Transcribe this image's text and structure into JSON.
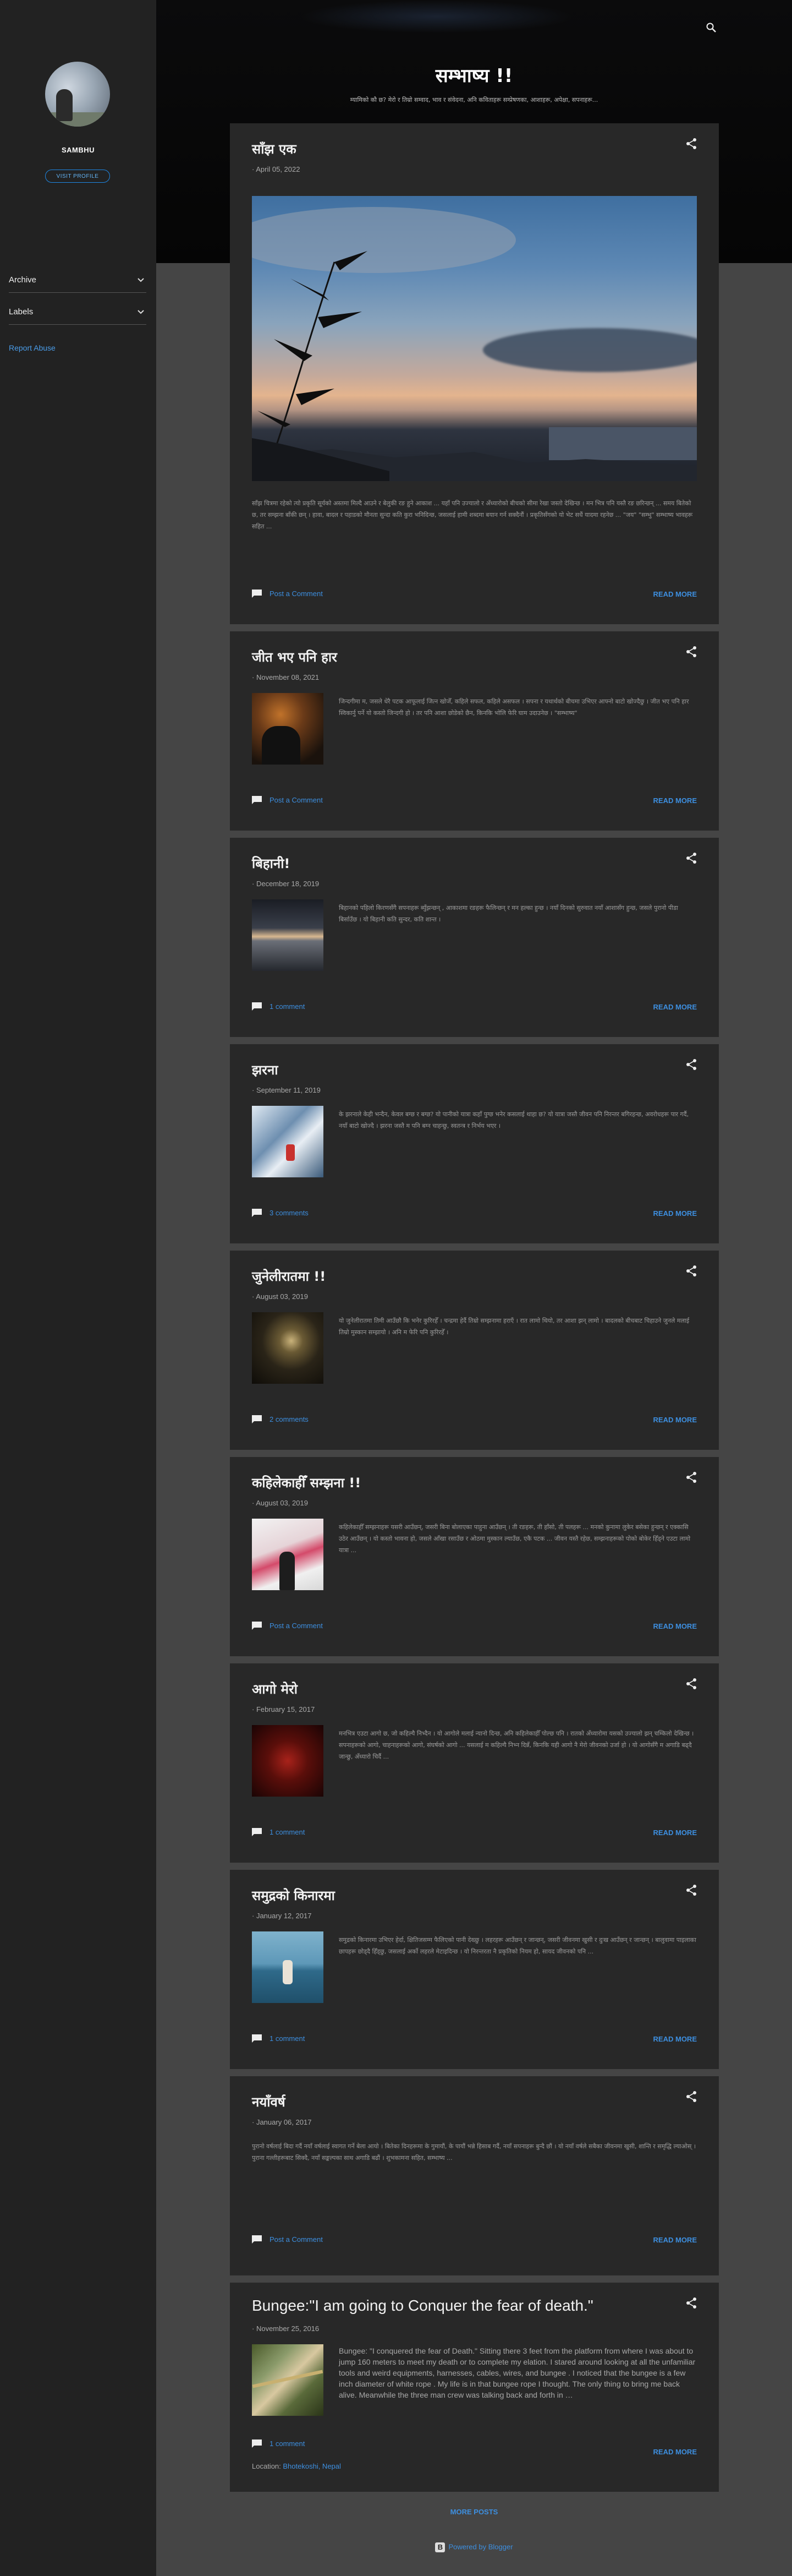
{
  "sidebar": {
    "profile_name": "SAMBHU",
    "visit_label": "VISIT PROFILE",
    "widgets": [
      {
        "label": "Archive"
      },
      {
        "label": "Labels"
      }
    ],
    "report_abuse": "Report Abuse"
  },
  "header": {
    "title": "सम्भाष्य !!",
    "description": "म्यामिको कौ छ? मेरो र तिम्रो सम्वाद, भाव र संवेदना, अनि कविताहरू सम्प्रेषणका, आशाहरू, अपेक्षा, सपनाहरू..."
  },
  "posts": [
    {
      "title": "साँझ एक",
      "date": "April 05, 2022",
      "snippet": "साँझ चित्रमा रहेको त्यो प्रकृति सूर्यको अस्तमा मिल्दै आउने र बेलुकी रङ हुने आकाश ... यहाँ पनि उज्यालो र अँध्यारोको बीचको सीमा रेखा जस्तो देखिन्छ । मन भित्र पनि यस्तै रङ छरिन्छन् ... समय बितेको छ, तर सम्झना बाँकी छन् । हावा, बादल र पहाडको मौनता सुन्दा कति कुरा भनिदिन्छ, जसलाई हामी शब्दमा बयान गर्न सक्दैनौं । प्रकृतिसँगको यो भेट सधैं यादमा रहनेछ ... \"जय\" \"सम्भु\" सम्भाष्य भावहरू सहित ...",
      "comment": "Post a Comment",
      "more": "READ MORE"
    },
    {
      "title": "जीत भए पनि हार",
      "date": "November 08, 2021",
      "snippet": "जिन्दगीमा म, जसले धेरै पटक आफूलाई जित्न खोजेँ, कहिले सफल, कहिले असफल । सपना र यथार्थको बीचमा उभिएर आफ्नो बाटो खोज्दैछु । जीत भए पनि हार स्विकार्नु पर्ने यो कस्तो जिन्दगी हो । तर पनि आशा छोडेको छैन, किनकि भोलि फेरि घाम उदाउनेछ । \"सम्भाष्य\"",
      "comment": "Post a Comment",
      "more": "READ MORE"
    },
    {
      "title": "बिहानी!",
      "date": "December 18, 2019",
      "snippet": "बिहानको पहिलो किरणसँगै सपनाहरू ब्युँझन्छन् , आकाशमा रङहरू फैलिन्छन् र मन हल्का हुन्छ । नयाँ दिनको सुरुवात नयाँ आशासँग हुन्छ, जसले पुरानो पीडा बिर्साउँछ । यो बिहानी कति सुन्दर, कति शान्त ।",
      "comment": "1 comment",
      "more": "READ MORE"
    },
    {
      "title": "झरना",
      "date": "September 11, 2019",
      "snippet": "के झरनाले केही भन्दैन, केवल बग्छ र बग्छ? यो पानीको यात्रा कहाँ पुग्छ भनेर कसलाई थाहा छ? यो यात्रा जस्तै जीवन पनि निरन्तर बगिरहन्छ, अवरोधहरू पार गर्दै, नयाँ बाटो खोज्दै । झरना जस्तै म पनि बग्न चाहन्छु, स्वतन्त्र र निर्भय भएर ।",
      "comment": "3 comments",
      "more": "READ MORE"
    },
    {
      "title": "जुनेलीरातमा !!",
      "date": "August 03, 2019",
      "snippet": "यो जुनेलीरातमा तिमी आउँछौ कि भनेर कुरिरहेँ । चन्द्रमा हेर्दै तिम्रो सम्झनामा हराएँ । रात लामो थियो, तर आशा झन् लामो । बादलको बीचबाट चिहाउने जुनले मलाई तिम्रो मुस्कान सम्झायो । अनि म फेरि पनि कुरिरहेँ ।",
      "comment": "2 comments",
      "more": "READ MORE"
    },
    {
      "title": "कहिलेकाहीँ सम्झना !!",
      "date": "August 03, 2019",
      "snippet": "कहिलेकाहीँ सम्झनाहरू यसरी आउँछन्, जसरी बिना बोलाएका पाहुना आउँछन् । ती रङहरू, ती हाँसो, ती पलहरू ... मनको कुनामा लुकेर बसेका हुन्छन् र एक्कासि उठेर आउँछन् । यो कस्तो भावना हो, जसले आँखा रसाउँछ र ओठमा मुस्कान ल्याउँछ, एकै पटक ... जीवन यस्तै रहेछ, सम्झनाहरूको पोको बोकेर हिँड्ने एउटा लामो यात्रा ...",
      "comment": "Post a Comment",
      "more": "READ MORE"
    },
    {
      "title": "आगो मेरो",
      "date": "February 15, 2017",
      "snippet": "मनभित्र एउटा आगो छ, जो कहिल्यै निभ्दैन । यो आगोले मलाई न्यानो दिन्छ, अनि कहिलेकाहीँ पोल्छ पनि । रातको अँध्यारोमा यसको उज्यालो झन् चम्किलो देखिन्छ । सपनाहरूको आगो, चाहनाहरूको आगो, संघर्षको आगो ... यसलाई म कहिल्यै निभ्न दिन्नँ, किनकि यही आगो नै मेरो जीवनको उर्जा हो । यो आगोसँगै म अगाडि बढ्दै जान्छु, अँध्यारो चिर्दै ...",
      "comment": "1 comment",
      "more": "READ MORE"
    },
    {
      "title": "समुद्रको किनारमा",
      "date": "January 12, 2017",
      "snippet": "समुद्रको किनारमा उभिएर हेर्दा, क्षितिजसम्म फैलिएको पानी देख्छु । लहरहरू आउँछन् र जान्छन्, जसरी जीवनमा खुसी र दुःख आउँछन् र जान्छन् । बालुवामा पाइलाका छापहरू छोड्दै हिँड्छु, जसलाई अर्को लहरले मेटाइदिन्छ । यो निरन्तरता नै प्रकृतिको नियम हो, सायद जीवनको पनि ...",
      "comment": "1 comment",
      "more": "READ MORE"
    },
    {
      "title": "नयाँवर्ष",
      "date": "January 06, 2017",
      "snippet": "पुरानो वर्षलाई बिदा गर्दै नयाँ वर्षलाई स्वागत गर्ने बेला आयो । बितेका दिनहरूमा के गुमायौं, के पायौं भन्ने हिसाब गर्दै, नयाँ सपनाहरू बुन्दै छौं । यो नयाँ वर्षले सबैका जीवनमा खुसी, शान्ति र समृद्धि ल्याओस् । पुराना गल्तीहरूबाट सिक्दै, नयाँ सङ्कल्पका साथ अगाडि बढौं । शुभकामना सहित, सम्भाष्य ...",
      "comment": "Post a Comment",
      "more": "READ MORE"
    },
    {
      "title": "Bungee:\"I am going to Conquer the fear of death.\"",
      "date": "November 25, 2016",
      "snippet": "Bungee: \"I conquered the fear of Death.\" Sitting there 3 feet from the platform from where I was about to jump 160 meters to meet my death or to complete my elation. I stared around looking at all the unfamiliar tools and weird equipments, harnesses, cables, wires, and bungee . I noticed that the bungee is a few inch diameter of white rope . My life is in that bungee rope I thought. The only thing to bring me back alive. Meanwhile the three man crew was talking back and forth in …",
      "comment": "1 comment",
      "more": "READ MORE",
      "location_label": "Location:",
      "location": "Bhotekoshi, Nepal"
    }
  ],
  "footer": {
    "more_posts": "MORE POSTS",
    "powered_by": "Powered by Blogger"
  },
  "colors": {
    "accent": "#3d8fe0",
    "card": "#282828",
    "page": "#454545",
    "sidebar": "#222222"
  }
}
